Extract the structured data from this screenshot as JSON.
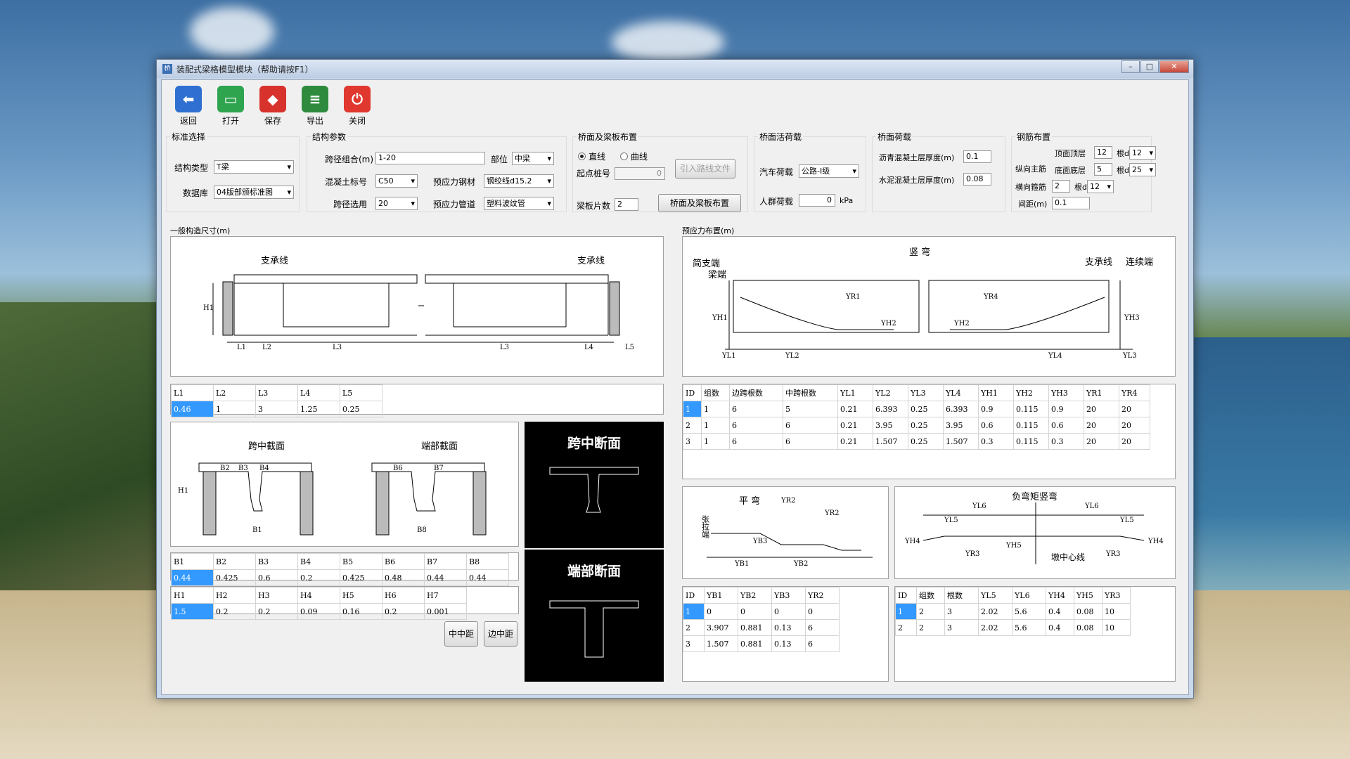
{
  "window": {
    "title": "装配式梁格模型模块（帮助请按F1）",
    "icon": "app-icon"
  },
  "toolbar": [
    {
      "label": "返回",
      "icon": "back-arrow-icon",
      "color": "#2f6fd1"
    },
    {
      "label": "打开",
      "icon": "open-folder-icon",
      "color": "#2ea44f"
    },
    {
      "label": "保存",
      "icon": "save-icon",
      "color": "#d8322c"
    },
    {
      "label": "导出",
      "icon": "export-icon",
      "color": "#2e8b3e"
    },
    {
      "label": "关闭",
      "icon": "power-icon",
      "color": "#e0382f"
    }
  ],
  "standard": {
    "title": "标准选择",
    "type_label": "结构类型",
    "type_value": "T梁",
    "db_label": "数据库",
    "db_value": "04版部颁标准图"
  },
  "struct": {
    "title": "结构参数",
    "span_label": "跨径组合(m)",
    "span_value": "1-20",
    "part_label": "部位",
    "part_value": "中梁",
    "concrete_label": "混凝土标号",
    "concrete_value": "C50",
    "steel_label": "预应力钢材",
    "steel_value": "钢绞线d15.2",
    "span_sel_label": "跨径选用",
    "span_sel_value": "20",
    "duct_label": "预应力管道",
    "duct_value": "塑料波纹管"
  },
  "deck": {
    "title": "桥面及梁板布置",
    "straight": "直线",
    "curve": "曲线",
    "start_label": "起点桩号",
    "start_value": "0",
    "import_btn": "引入路线文件",
    "count_label": "梁板片数",
    "count_value": "2",
    "layout_btn": "桥面及梁板布置"
  },
  "live": {
    "title": "桥面活荷载",
    "car_label": "汽车荷载",
    "car_value": "公路-I级",
    "crowd_label": "人群荷载",
    "crowd_value": "0",
    "crowd_unit": "kPa"
  },
  "deckload": {
    "title": "桥面荷载",
    "asphalt_label": "沥青混凝土层厚度(m)",
    "asphalt_value": "0.1",
    "cement_label": "水泥混凝土层厚度(m)",
    "cement_value": "0.08"
  },
  "rebar": {
    "title": "钢筋布置",
    "top_label": "顶面顶层",
    "top_count": "12",
    "top_d_label": "根d",
    "top_d": "12",
    "long_label": "纵向主筋",
    "bottom_label": "底面底层",
    "bottom_count": "5",
    "bottom_d_label": "根d",
    "bottom_d": "25",
    "stirrup_label": "横向箍筋",
    "stirrup_count": "2",
    "stirrup_d_label": "根d",
    "stirrup_d": "12",
    "spacing_label": "间距(m)",
    "spacing_value": "0.1"
  },
  "general": {
    "title": "一般构造尺寸(m)",
    "support": "支承线",
    "L_headers": [
      "L1",
      "L2",
      "L3",
      "L4",
      "L5"
    ],
    "L_values": [
      "0.46",
      "1",
      "3",
      "1.25",
      "0.25"
    ],
    "mid_section": "跨中截面",
    "end_section": "端部截面",
    "B_headers": [
      "B1",
      "B2",
      "B3",
      "B4",
      "B5",
      "B6",
      "B7",
      "B8"
    ],
    "B_values": [
      "0.44",
      "0.425",
      "0.6",
      "0.2",
      "0.425",
      "0.48",
      "0.44",
      "0.44"
    ],
    "H_headers": [
      "H1",
      "H2",
      "H3",
      "H4",
      "H5",
      "H6",
      "H7"
    ],
    "H_values": [
      "1.5",
      "0.2",
      "0.2",
      "0.09",
      "0.16",
      "0.2",
      "0.001"
    ],
    "btn_mid": "中中距",
    "btn_edge": "边中距",
    "mid_title": "跨中断面",
    "end_title": "端部断面"
  },
  "prestress": {
    "title": "预应力布置(m)",
    "vertical": "竖 弯",
    "simple_end": "简支端",
    "beam_end": "梁端",
    "support": "支承线",
    "cont_end": "连续端",
    "headers": [
      "ID",
      "组数",
      "边跨根数",
      "中跨根数",
      "YL1",
      "YL2",
      "YL3",
      "YL4",
      "YH1",
      "YH2",
      "YH3",
      "YR1",
      "YR4"
    ],
    "rows": [
      [
        "1",
        "1",
        "6",
        "5",
        "0.21",
        "6.393",
        "0.25",
        "6.393",
        "0.9",
        "0.115",
        "0.9",
        "20",
        "20"
      ],
      [
        "2",
        "1",
        "6",
        "6",
        "0.21",
        "3.95",
        "0.25",
        "3.95",
        "0.6",
        "0.115",
        "0.6",
        "20",
        "20"
      ],
      [
        "3",
        "1",
        "6",
        "6",
        "0.21",
        "1.507",
        "0.25",
        "1.507",
        "0.3",
        "0.115",
        "0.3",
        "20",
        "20"
      ]
    ],
    "flat": "平 弯",
    "tension_end": "张拉端",
    "flat_headers": [
      "ID",
      "YB1",
      "YB2",
      "YB3",
      "YR2"
    ],
    "flat_rows": [
      [
        "1",
        "0",
        "0",
        "0",
        "0"
      ],
      [
        "2",
        "3.907",
        "0.881",
        "0.13",
        "6"
      ],
      [
        "3",
        "1.507",
        "0.881",
        "0.13",
        "6"
      ]
    ],
    "neg": "负弯矩竖弯",
    "pier": "墩中心线",
    "neg_headers": [
      "ID",
      "组数",
      "根数",
      "YL5",
      "YL6",
      "YH4",
      "YH5",
      "YR3"
    ],
    "neg_rows": [
      [
        "1",
        "2",
        "3",
        "2.02",
        "5.6",
        "0.4",
        "0.08",
        "10"
      ],
      [
        "2",
        "2",
        "3",
        "2.02",
        "5.6",
        "0.4",
        "0.08",
        "10"
      ]
    ]
  }
}
